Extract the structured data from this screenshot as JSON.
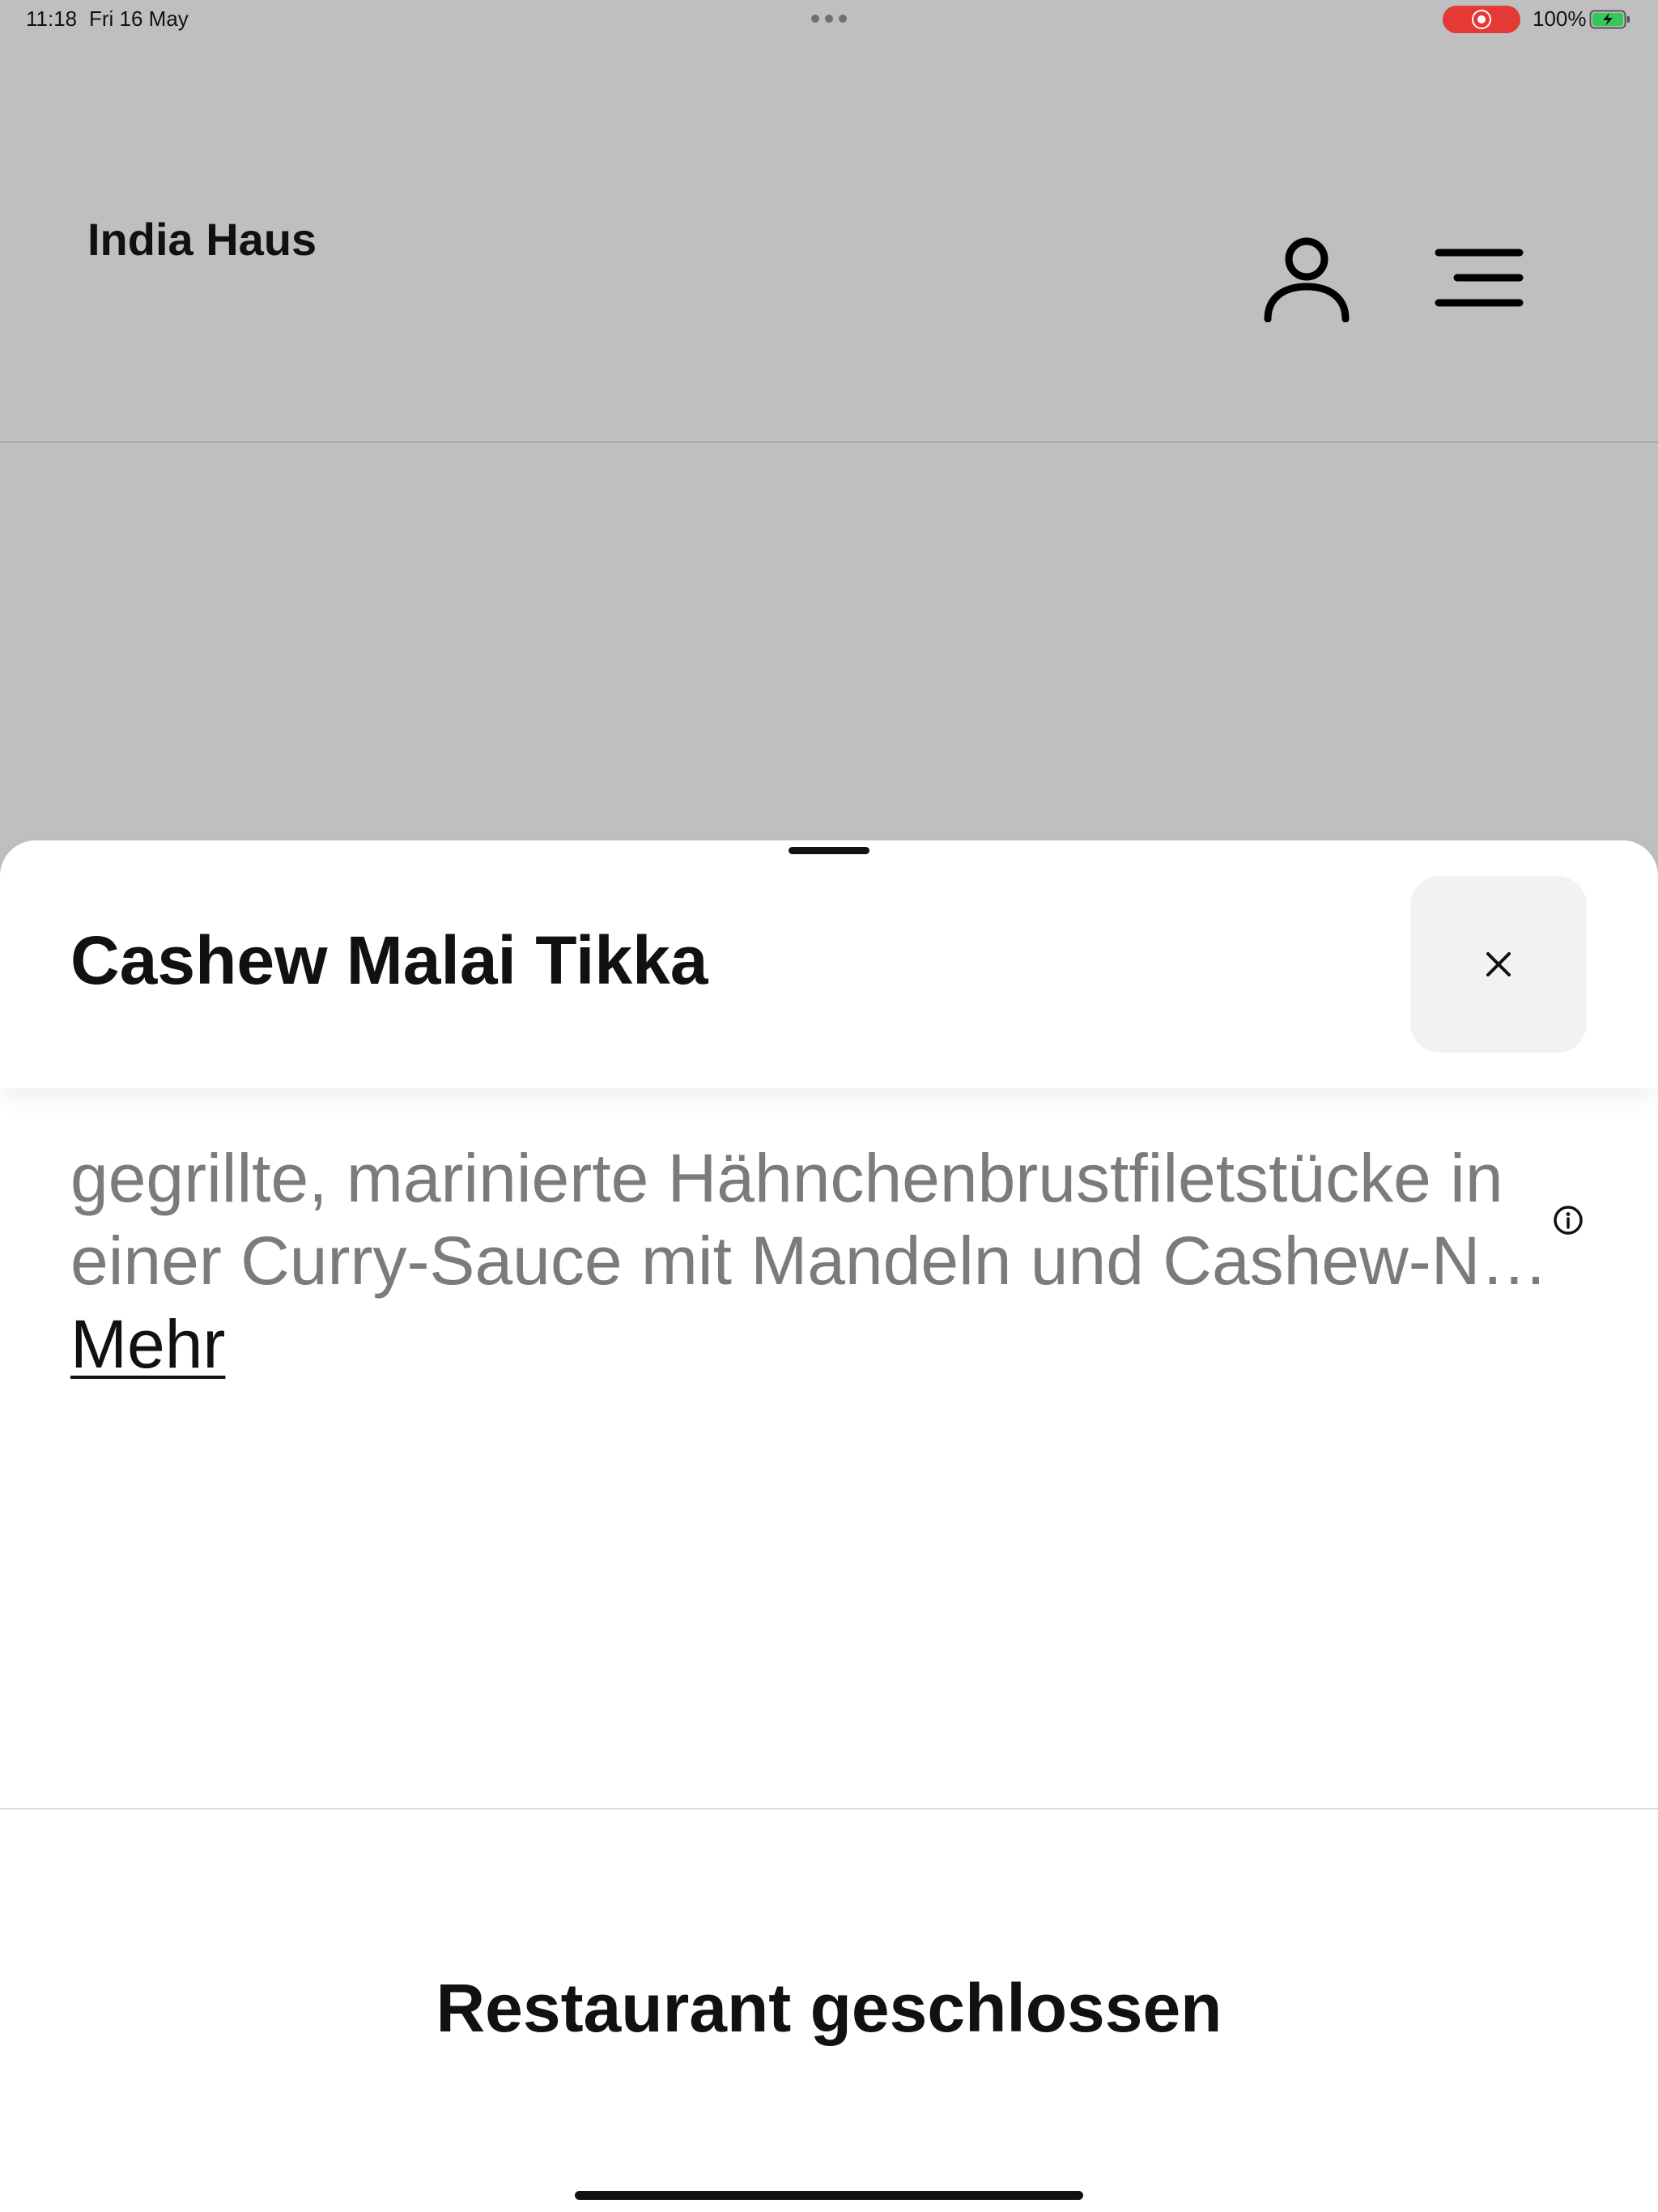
{
  "status_bar": {
    "time": "11:18",
    "date": "Fri 16 May",
    "battery_percent": "100%",
    "battery_level": 1.0,
    "charging": true,
    "recording_indicator_color": "#e53935",
    "battery_color": "#34c759"
  },
  "header": {
    "title": "India Haus",
    "account_icon": "user-icon",
    "menu_icon": "menu-icon"
  },
  "sheet": {
    "dish_name": "Cashew Malai Tikka",
    "close_icon": "close-icon",
    "description_lines": [
      "gegrillte, marinierte Hähnchenbrustfiletstücke in",
      "einer Curry-Sauce mit Mandeln und Cashew-N…"
    ],
    "more_label": "Mehr",
    "info_icon": "info-icon",
    "status_message": "Restaurant geschlossen"
  },
  "colors": {
    "overlay_background": "#bfbfbf",
    "sheet_background": "#ffffff",
    "close_button_background": "#f2f2f2",
    "description_text": "#7b7b7b"
  }
}
